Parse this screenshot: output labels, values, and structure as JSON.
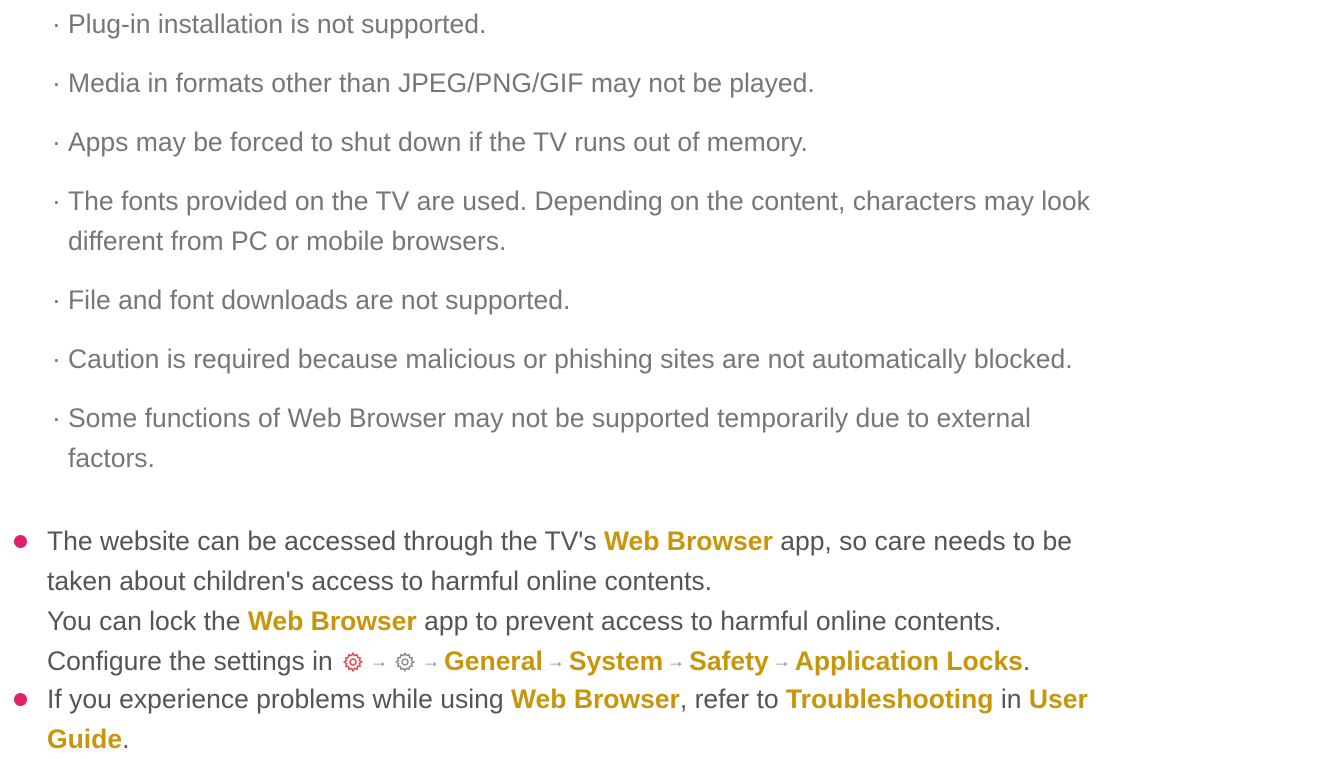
{
  "notes": [
    {
      "lines": [
        "Plug-in installation is not supported."
      ]
    },
    {
      "lines": [
        "Media in formats other than JPEG/PNG/GIF may not be played."
      ]
    },
    {
      "lines": [
        "Apps may be forced to shut down if the TV runs out of memory."
      ]
    },
    {
      "lines": [
        "The fonts provided on the TV are used. Depending on the content, characters may look",
        "different from PC or mobile browsers."
      ]
    },
    {
      "lines": [
        "File and font downloads are not supported."
      ]
    },
    {
      "lines": [
        "Caution is required because malicious or phishing sites are not automatically blocked."
      ]
    },
    {
      "lines": [
        "Some functions of Web Browser may not be supported temporarily due to external",
        "factors."
      ]
    }
  ],
  "bullet_marker": "·",
  "main": {
    "item1": {
      "l1_a": "The website can be accessed through the TV's ",
      "l1_b": "Web Browser",
      "l1_c": " app, so care needs to be",
      "l2": "taken about children's access to harmful online contents.",
      "l3_a": "You can lock the ",
      "l3_b": "Web Browser",
      "l3_c": " app to prevent access to harmful online contents.",
      "l4_a": "Configure the settings in ",
      "path": [
        "General",
        "System",
        "Safety",
        "Application Locks"
      ],
      "l4_end": ".",
      "arrow": "→"
    },
    "item2": {
      "l1_a": "If you experience problems while using ",
      "l1_b": "Web Browser",
      "l1_c": ", refer to ",
      "l1_d": "Troubleshooting",
      "l1_e": " in ",
      "l1_f": "User",
      "l2_a": "Guide",
      "l2_b": "."
    }
  },
  "colors": {
    "accent": "#c8960a",
    "bullet": "#e0206a",
    "text": "#555555",
    "subtext": "#777777",
    "settings_icon_red": "#e05050",
    "settings_icon_gray": "#888888"
  },
  "icons": [
    "settings-gear-red-icon",
    "settings-gear-gray-icon",
    "arrow-right-icon"
  ]
}
